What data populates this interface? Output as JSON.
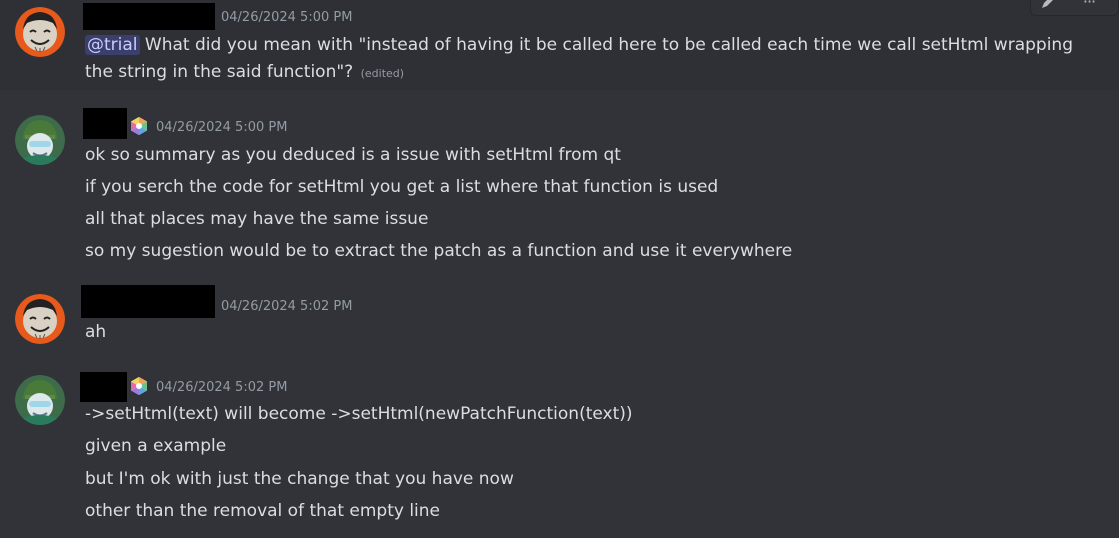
{
  "colors": {
    "background": "#313338",
    "hover_background": "#2e3035",
    "text": "#dbdee1",
    "timestamp": "#949ba4",
    "mention_bg": "rgba(88,101,242,0.3)",
    "mention_text": "#c9cdfb"
  },
  "toolbar": {
    "edit_icon": "pencil-icon",
    "more_icon": "more-icon",
    "more_label": "···"
  },
  "messages": [
    {
      "timestamp": "04/26/2024 5:00 PM",
      "mention": "@trial",
      "lines": [
        " What did you mean with \"instead of having it be called here to be called each time we call setHtml wrapping",
        "the string in the said function\"?"
      ],
      "edited": "(edited)"
    },
    {
      "timestamp": "04/26/2024 5:00 PM",
      "lines": [
        "ok so summary as you deduced is a issue with setHtml from qt",
        "if you serch the code for setHtml you get a list where that function is used",
        "all that places may have the same issue",
        "so my sugestion would be to extract the patch as a function and use it everywhere"
      ]
    },
    {
      "timestamp": "04/26/2024 5:02 PM",
      "lines": [
        "ah"
      ]
    },
    {
      "timestamp": "04/26/2024 5:02 PM",
      "lines": [
        "->setHtml(text) will become ->setHtml(newPatchFunction(text))",
        "given a example",
        "but I'm ok with just the change that you have now",
        "other than the removal of that empty line"
      ]
    }
  ]
}
